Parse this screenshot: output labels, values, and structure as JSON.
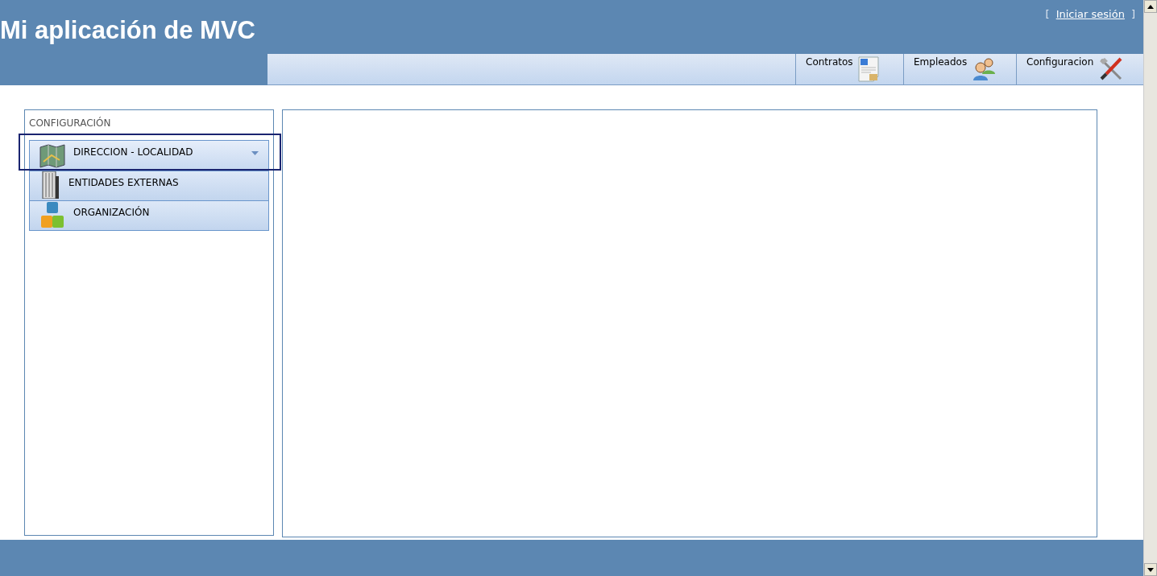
{
  "header": {
    "title": "Mi aplicación de MVC",
    "login": {
      "open": "[",
      "link": "Iniciar sesión",
      "close": "]"
    }
  },
  "nav": [
    {
      "label": "Contratos",
      "kind": "document"
    },
    {
      "label": "Empleados",
      "kind": "people"
    },
    {
      "label": "Configuracion",
      "kind": "tools"
    }
  ],
  "sidebar": {
    "heading": "CONFIGURACIÓN",
    "items": [
      {
        "label": "DIRECCION - LOCALIDAD",
        "kind": "map",
        "selected": true
      },
      {
        "label": "ENTIDADES EXTERNAS",
        "kind": "building",
        "selected": false
      },
      {
        "label": "ORGANIZACIÓN",
        "kind": "blocks",
        "selected": false
      }
    ]
  }
}
